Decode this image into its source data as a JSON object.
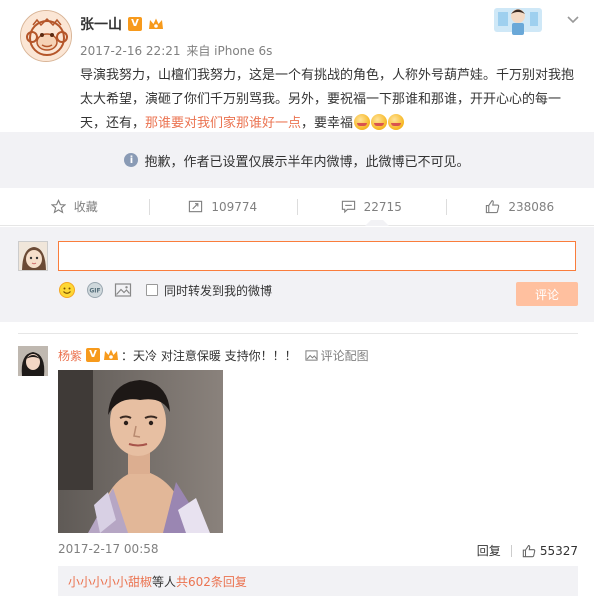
{
  "post": {
    "author": "张一山",
    "time": "2017-2-16 22:21",
    "source": "来自 iPhone 6s",
    "text_part1": "导演我努力，山檀们我努力，这是一个有挑战的角色，人称外号葫芦娃。千万别对我抱太大希望，演砸了你们千万别骂我。另外，要祝福一下那谁和那谁，开开心心的每一天，还有，",
    "text_highlight": "那谁要对我们家那谁好一点",
    "text_part2": "，要幸福"
  },
  "notice": {
    "text": "抱歉，作者已设置仅展示半年内微博，此微博已不可见。"
  },
  "actions": {
    "favorite": "收藏",
    "repost_count": "109774",
    "comment_count": "22715",
    "like_count": "238086"
  },
  "compose": {
    "placeholder": "",
    "forward_label": "同时转发到我的微博",
    "submit": "评论"
  },
  "comment": {
    "user": "杨紫",
    "text": "：天冷 对注意保暖 支持你！！！",
    "pic_link": "评论配图",
    "time": "2017-2-17 00:58",
    "reply": "回复",
    "likes": "55327",
    "reply_users": "小小小小小甜椒",
    "reply_mid": " 等人 ",
    "reply_total": "共602条回复"
  },
  "colors": {
    "accent": "#eb7350",
    "badge": "#f79a1c",
    "bg_gray": "#f2f2f5",
    "muted": "#808080"
  },
  "icons": [
    "star-icon",
    "repost-icon",
    "comment-icon",
    "like-icon",
    "info-icon",
    "smile-icon",
    "gif-icon",
    "image-icon",
    "chevron-down-icon"
  ]
}
